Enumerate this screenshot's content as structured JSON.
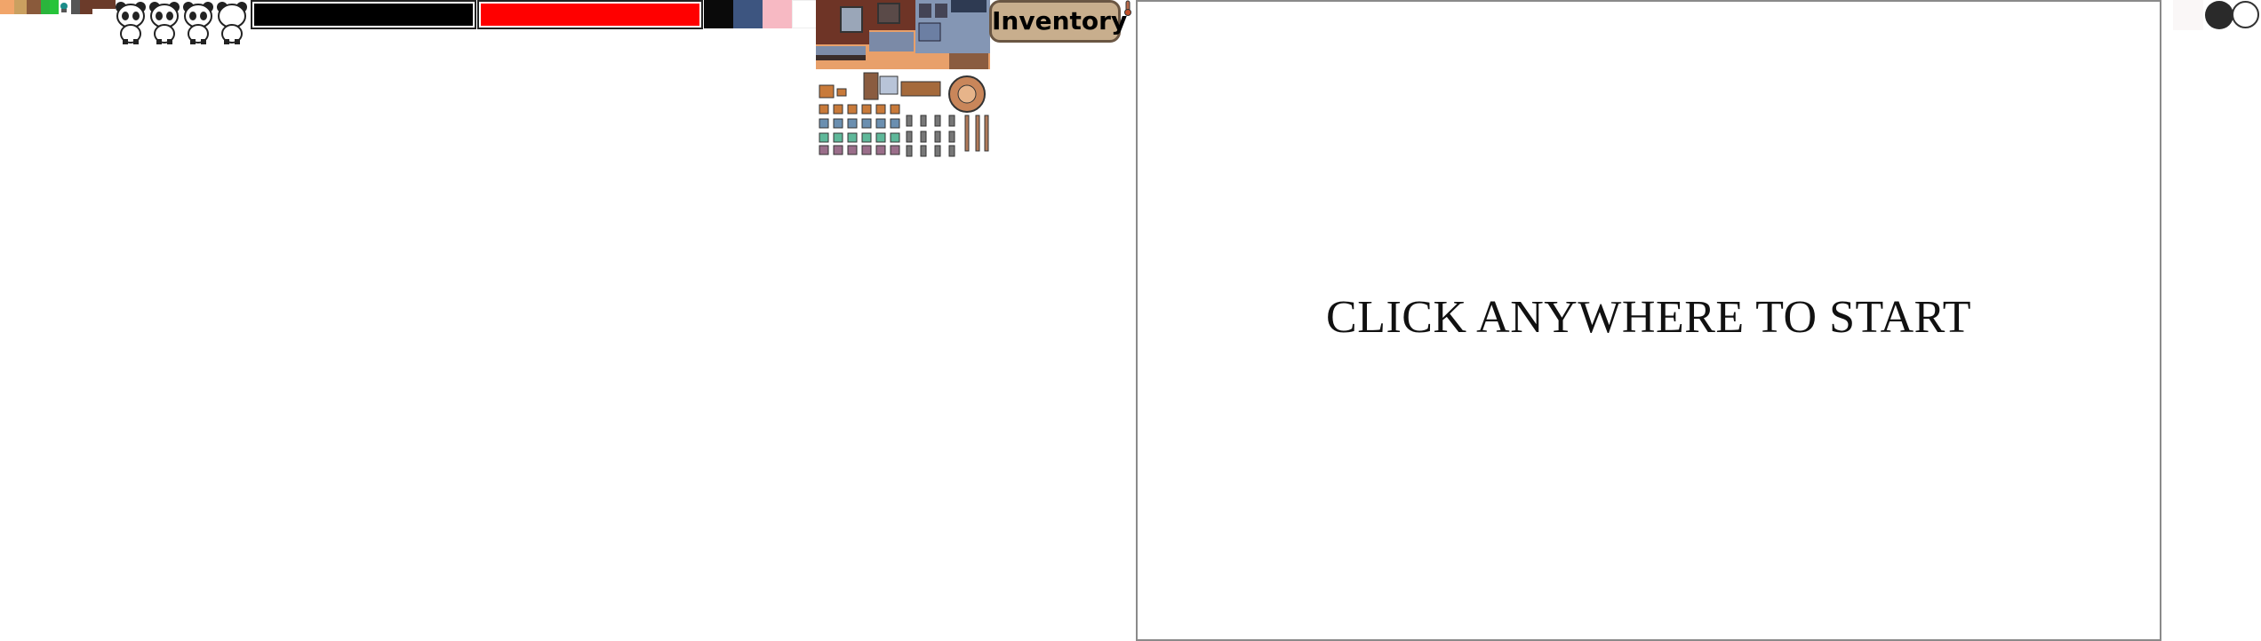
{
  "inventory": {
    "label": "Inventory"
  },
  "canvas": {
    "prompt": "CLICK ANYWHERE TO START"
  },
  "palette": {
    "swatches": [
      "#f1a56a",
      "#caa060",
      "#8a5a3b",
      "#2ab53c",
      "#27c43a",
      "#1b8d8a",
      "#555555",
      "#6b3b2a"
    ],
    "tiles": [
      "#0a0a0a",
      "#3d5580",
      "#f7b9c3",
      "#ffffff"
    ],
    "bar_colors": {
      "health": "#ff0000",
      "stamina": "#000000"
    },
    "inventory_bg": "#c8ae8d",
    "inventory_border": "#6a5643"
  },
  "icons": {
    "panda_sprites": [
      "panda-sprite-icon",
      "panda-sprite-icon",
      "panda-sprite-icon",
      "panda-sprite-icon"
    ],
    "tileset": "furniture-tileset-icon",
    "thermometer": "thermometer-icon"
  },
  "bars": {
    "black_fill": 1.0,
    "red_fill": 1.0
  }
}
